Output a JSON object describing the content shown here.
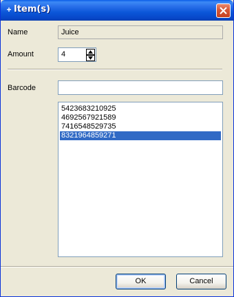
{
  "window": {
    "title": "Item(s)",
    "title_icon": "+"
  },
  "form": {
    "name_label": "Name",
    "name_value": "Juice",
    "amount_label": "Amount",
    "amount_value": "4",
    "barcode_label": "Barcode",
    "barcode_value": ""
  },
  "barcodes": {
    "items": [
      "5423683210925",
      "4692567921589",
      "7416548529735",
      "8321964859271"
    ],
    "selected": "8321964859271"
  },
  "buttons": {
    "ok_label": "OK",
    "cancel_label": "Cancel"
  },
  "colors": {
    "titlebar": "#0b56d8",
    "selection": "#316ac5",
    "dialog_bg": "#ece9d8",
    "close_button": "#d85a3a"
  }
}
